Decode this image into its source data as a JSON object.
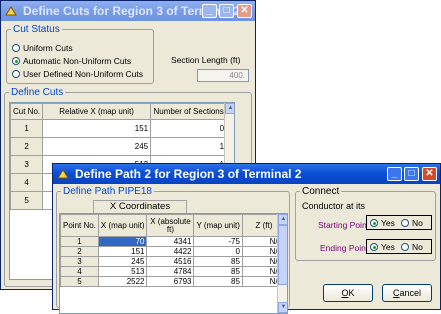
{
  "window1": {
    "title": "Define Cuts for Region 3 of Terminal 2",
    "cut_status": {
      "legend": "Cut Status",
      "options": [
        {
          "label": "Uniform Cuts",
          "selected": false
        },
        {
          "label": "Automatic Non-Uniform Cuts",
          "selected": true
        },
        {
          "label": "User Defined Non-Uniform Cuts",
          "selected": false
        }
      ]
    },
    "section_length_label": "Section Length (ft)",
    "section_length_value": "400.",
    "define_cuts": {
      "legend": "Define Cuts",
      "headers": [
        "Cut No.",
        "Relative X (map unit)",
        "Number of Sections"
      ],
      "rows": [
        [
          "1",
          "151",
          "0"
        ],
        [
          "2",
          "245",
          "1"
        ],
        [
          "3",
          "513",
          "1"
        ],
        [
          "4",
          "",
          "1"
        ],
        [
          "5",
          "",
          "1"
        ]
      ]
    }
  },
  "window2": {
    "title": "Define Path 2 for Region 3 of Terminal 2",
    "define_path": {
      "legend": "Define Path PIPE18",
      "group_header": "X Coordinates",
      "headers": [
        "Point No.",
        "X (map unit)",
        "X (absolute ft)",
        "Y (map unit)",
        "Z (ft)"
      ],
      "rows": [
        [
          "1",
          "70",
          "4341",
          "-75",
          "N/A"
        ],
        [
          "2",
          "151",
          "4422",
          "0",
          "N/A"
        ],
        [
          "3",
          "245",
          "4516",
          "85",
          "N/A"
        ],
        [
          "4",
          "513",
          "4784",
          "85",
          "N/A"
        ],
        [
          "5",
          "2522",
          "6793",
          "85",
          "N/A"
        ]
      ]
    },
    "connect": {
      "legend": "Connect",
      "text": "Conductor at its",
      "starting_label": "Starting Point:",
      "ending_label": "Ending Point:",
      "yes": "Yes",
      "no": "No",
      "starting_selected": "Yes",
      "ending_selected": "Yes"
    },
    "ok": {
      "mnemonic": "O",
      "rest": "K"
    },
    "cancel": {
      "mnemonic": "C",
      "rest": "ancel"
    }
  },
  "colors": {
    "title_active": "#0b4fd6",
    "title_inactive": "#7a9fe8",
    "legend_blue": "#0046d5",
    "connect_label": "#800080",
    "dialog_bg": "#ece9d8"
  }
}
